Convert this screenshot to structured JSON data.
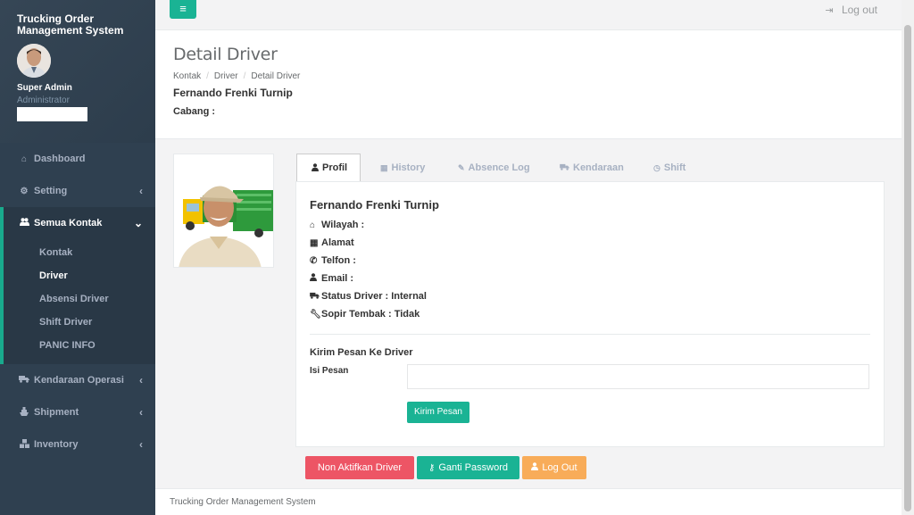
{
  "app": {
    "title": "Trucking Order Management System"
  },
  "profile": {
    "name": "Super Admin",
    "role": "Administrator"
  },
  "sidebar": {
    "items": [
      {
        "label": "Dashboard",
        "icon": "home-icon"
      },
      {
        "label": "Setting",
        "icon": "gears-icon"
      },
      {
        "label": "Semua Kontak",
        "icon": "users-icon"
      },
      {
        "label": "Kendaraan Operasi",
        "icon": "truck-icon"
      },
      {
        "label": "Shipment",
        "icon": "ship-icon"
      },
      {
        "label": "Inventory",
        "icon": "cubes-icon"
      }
    ],
    "subitems": [
      "Kontak",
      "Driver",
      "Absensi Driver",
      "Shift Driver",
      "PANIC INFO"
    ]
  },
  "topbar": {
    "logout_label": "Log out"
  },
  "heading": {
    "title": "Detail Driver",
    "breadcrumb": [
      "Kontak",
      "Driver",
      "Detail Driver"
    ],
    "driver_name": "Fernando Frenki Turnip",
    "cabang_label": "Cabang :"
  },
  "tabs": [
    {
      "label": "Profil",
      "icon": "user-icon"
    },
    {
      "label": "History",
      "icon": "calendar-icon"
    },
    {
      "label": "Absence Log",
      "icon": "edit-icon"
    },
    {
      "label": "Kendaraan",
      "icon": "truck-icon"
    },
    {
      "label": "Shift",
      "icon": "clock-icon"
    }
  ],
  "profil": {
    "name": "Fernando Frenki Turnip",
    "fields": [
      {
        "label": "Wilayah :",
        "icon": "home-icon"
      },
      {
        "label": "Alamat",
        "icon": "calendar-icon"
      },
      {
        "label": "Telfon :",
        "icon": "phone-icon"
      },
      {
        "label": "Email :",
        "icon": "user-icon"
      },
      {
        "label": "Status Driver : Internal",
        "icon": "truck-icon"
      },
      {
        "label": "Sopir Tembak : Tidak",
        "icon": "wrench-icon"
      }
    ]
  },
  "message": {
    "title": "Kirim Pesan Ke Driver",
    "field_label": "Isi Pesan",
    "value": "",
    "button": "Kirim Pesan"
  },
  "actions": {
    "deactivate": "Non Aktifkan Driver",
    "password": "Ganti Password",
    "logout": "Log Out"
  },
  "footer": {
    "text": "Trucking Order Management System"
  },
  "colors": {
    "sidebar": "#2f4050",
    "primary": "#1ab394",
    "danger": "#ed5565",
    "warning": "#f8ac59"
  }
}
